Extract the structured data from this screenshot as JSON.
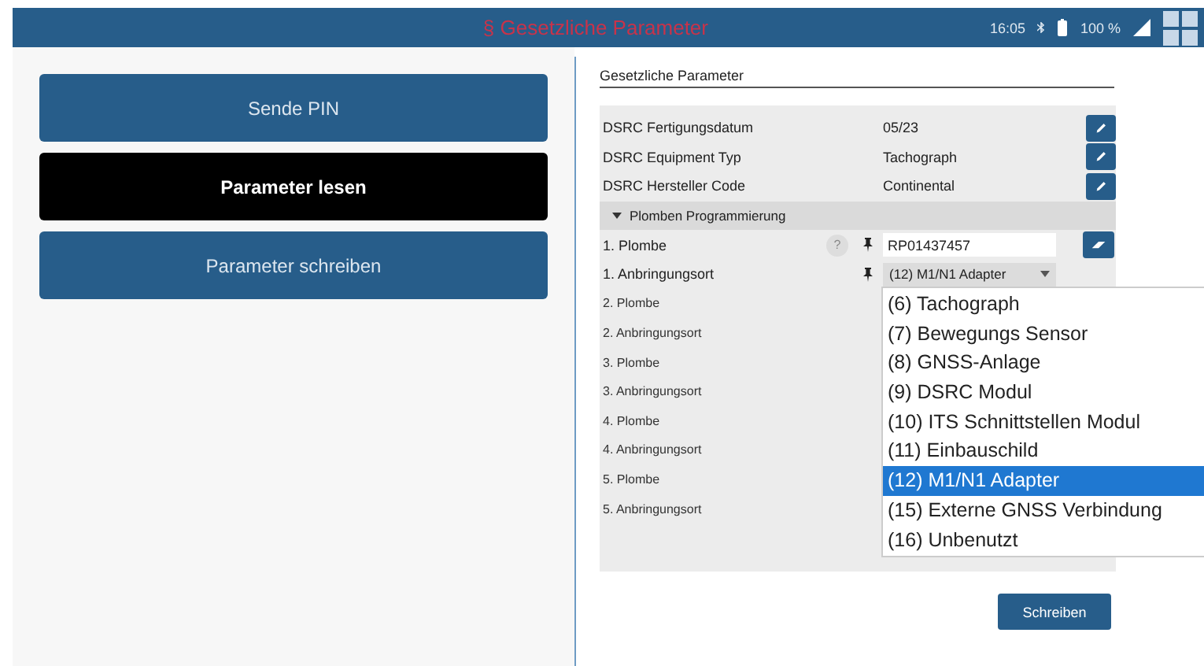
{
  "title_bar": {
    "title": "§ Gesetzliche Parameter",
    "time": "16:05",
    "battery": "100 %"
  },
  "actions": [
    {
      "label": "Sende PIN",
      "selected": false
    },
    {
      "label": "Parameter lesen",
      "selected": true
    },
    {
      "label": "Parameter schreiben",
      "selected": false
    }
  ],
  "panel": {
    "heading": "Gesetzliche Parameter",
    "rows": [
      {
        "kind": "param",
        "label": "DSRC Fertigungsdatum",
        "value": "05/23"
      },
      {
        "kind": "param",
        "label": "DSRC Equipment Typ",
        "value": "Tachograph"
      },
      {
        "kind": "param",
        "label": "DSRC Hersteller Code",
        "value": "Continental"
      },
      {
        "kind": "section",
        "label": "Plomben Programmierung",
        "expanded": true
      },
      {
        "kind": "seal",
        "label": "1. Plombe",
        "help": "?",
        "value": "RP01437457"
      },
      {
        "kind": "mount",
        "label": "1. Anbringungsort",
        "value": "(12) M1/N1 Adapter"
      },
      {
        "kind": "plain",
        "label": "2. Plombe"
      },
      {
        "kind": "plain",
        "label": "2. Anbringungsort"
      },
      {
        "kind": "plain",
        "label": "3. Plombe"
      },
      {
        "kind": "plain",
        "label": "3. Anbringungsort"
      },
      {
        "kind": "plain",
        "label": "4. Plombe"
      },
      {
        "kind": "plain",
        "label": "4. Anbringungsort"
      },
      {
        "kind": "plain",
        "label": "5. Plombe"
      },
      {
        "kind": "plain",
        "label": "5. Anbringungsort"
      }
    ],
    "dropdown": [
      {
        "label": "(6) Tachograph",
        "selected": false
      },
      {
        "label": "(7) Bewegungs Sensor",
        "selected": false
      },
      {
        "label": "(8) GNSS-Anlage",
        "selected": false
      },
      {
        "label": "(9) DSRC Modul",
        "selected": false
      },
      {
        "label": "(10) ITS Schnittstellen Modul",
        "selected": false
      },
      {
        "label": "(11) Einbauschild",
        "selected": false
      },
      {
        "label": "(12) M1/N1 Adapter",
        "selected": true
      },
      {
        "label": "(15) Externe GNSS Verbindung",
        "selected": false
      },
      {
        "label": "(16) Unbenutzt",
        "selected": false
      }
    ],
    "write_button": "Schreiben"
  }
}
